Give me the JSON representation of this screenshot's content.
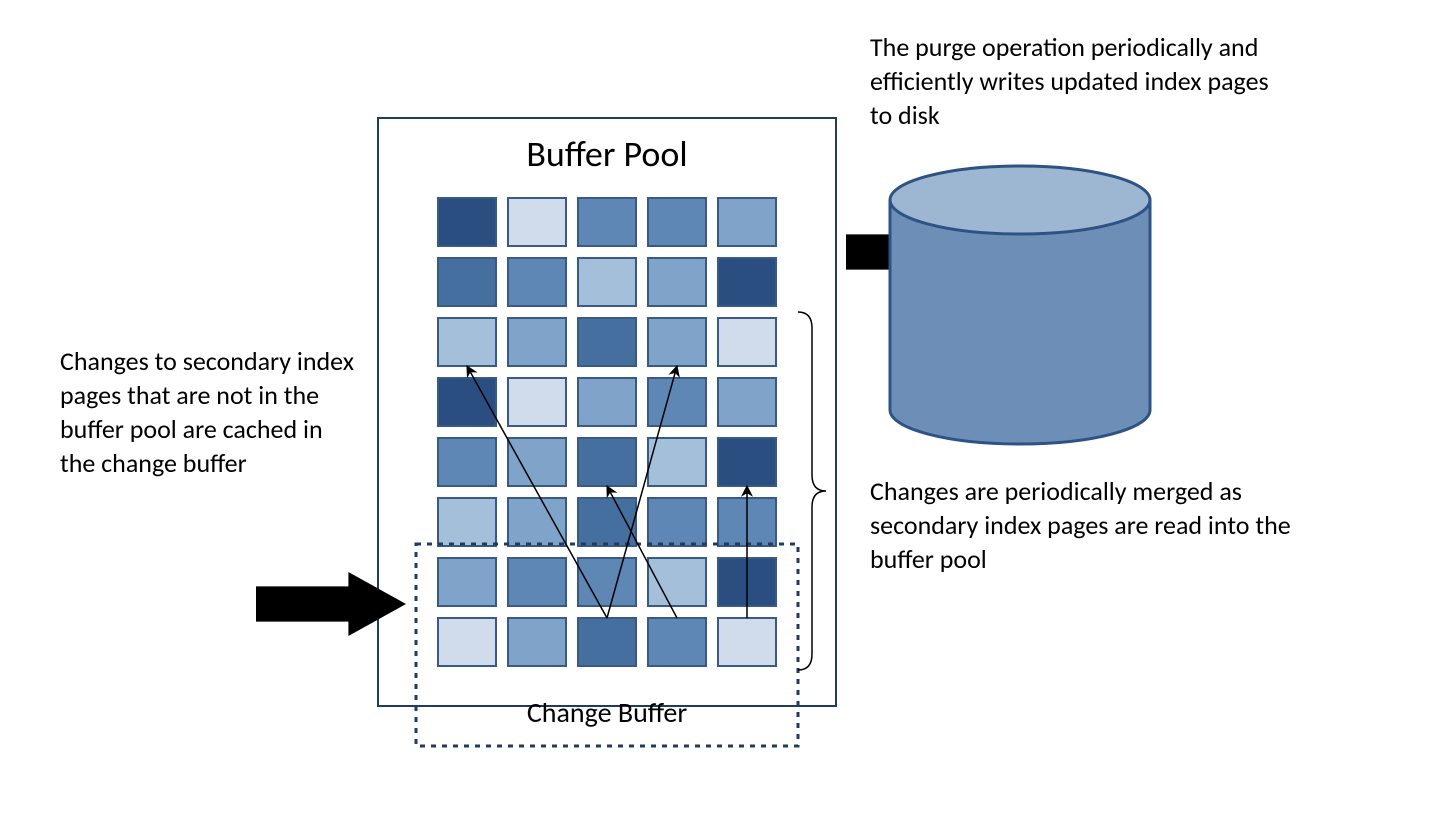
{
  "labels": {
    "bufferPoolTitle": "Buffer Pool",
    "changeBufferTitle": "Change Buffer",
    "leftCaption": "Changes to secondary index pages that are not in the buffer pool are cached in the change buffer",
    "topRightCaption": "The purge operation periodically and efficiently writes updated index pages to disk",
    "rightCaption": "Changes are periodically merged as secondary index pages are read into the buffer pool"
  },
  "palette": {
    "c1": "#2a4e80",
    "c2": "#446f9e",
    "c3": "#5f87b6",
    "c4": "#7fa3c9",
    "c5": "#a4bfda",
    "c6": "#d0dceb",
    "stroke": "#3a5a86",
    "outline": "#203a60",
    "diskFill": "#6d8fb7",
    "diskStroke": "#2f5284"
  },
  "grid": {
    "cols": 5,
    "rows": 8,
    "cells": [
      [
        "c1",
        "c6",
        "c3",
        "c3",
        "c4"
      ],
      [
        "c2",
        "c3",
        "c5",
        "c4",
        "c1"
      ],
      [
        "c5",
        "c4",
        "c2",
        "c4",
        "c6"
      ],
      [
        "c1",
        "c6",
        "c4",
        "c3",
        "c4"
      ],
      [
        "c3",
        "c4",
        "c2",
        "c5",
        "c1"
      ],
      [
        "c5",
        "c4",
        "c2",
        "c3",
        "c3"
      ],
      [
        "c4",
        "c3",
        "c3",
        "c5",
        "c1"
      ],
      [
        "c6",
        "c4",
        "c2",
        "c3",
        "c6"
      ]
    ]
  },
  "mergeArrows": [
    {
      "from": [
        2,
        7
      ],
      "to": [
        0,
        2
      ]
    },
    {
      "from": [
        2,
        7
      ],
      "to": [
        3,
        2
      ]
    },
    {
      "from": [
        3,
        7
      ],
      "to": [
        2,
        4
      ]
    },
    {
      "from": [
        4,
        7
      ],
      "to": [
        4,
        4
      ]
    }
  ]
}
